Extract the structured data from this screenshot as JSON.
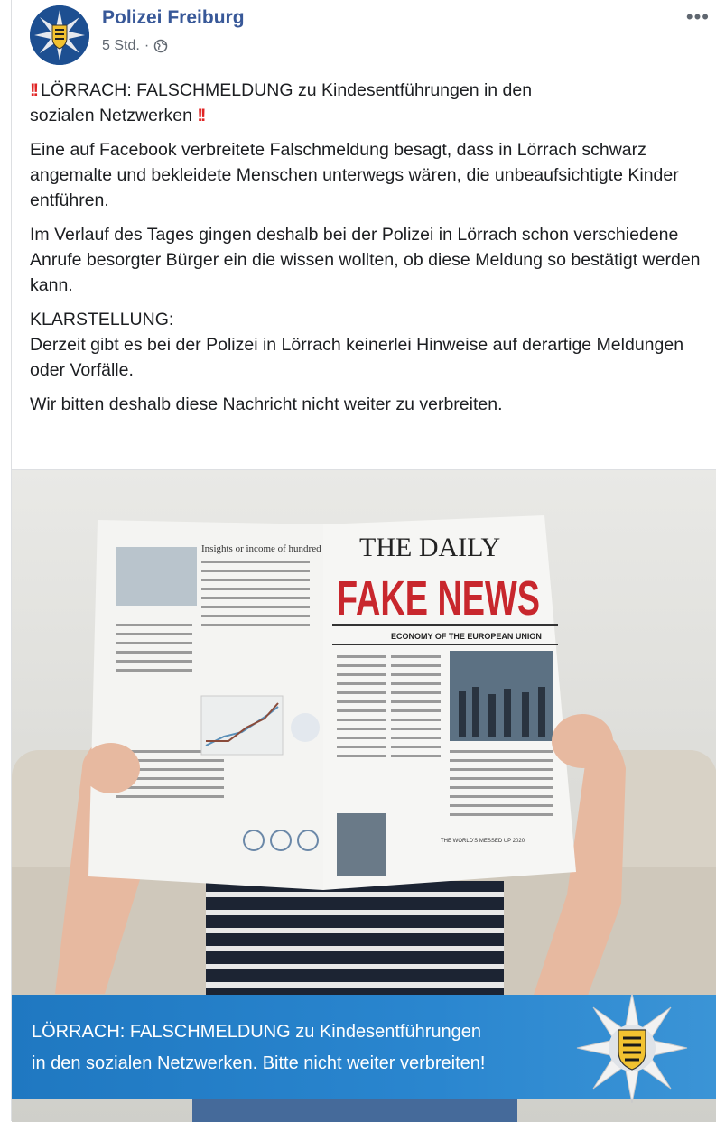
{
  "post": {
    "page_name": "Polizei Freiburg",
    "timestamp": "5 Std.",
    "separator": "·",
    "more_label": "•••",
    "headline_line1": "LÖRRACH: FALSCHMELDUNG zu Kindesentführungen in den",
    "headline_line2": "sozialen Netzwerken",
    "paragraph1": "Eine auf Facebook verbreitete Falschmeldung besagt, dass in Lörrach schwarz angemalte und bekleidete Menschen unterwegs wären, die unbeaufsichtigte Kinder entführen.",
    "paragraph2": "Im Verlauf des Tages gingen deshalb bei der Polizei in Lörrach schon verschiedene Anrufe besorgter Bürger ein die wissen wollten, ob diese Meldung so bestätigt werden kann.",
    "clarification_label": "KLARSTELLUNG:",
    "clarification_text": "Derzeit gibt es bei der Polizei in Lörrach keinerlei Hinweise auf derartige Meldungen oder Vorfälle.",
    "closing": "Wir bitten deshalb diese Nachricht nicht weiter zu verbreiten."
  },
  "image": {
    "newspaper_title1": "THE DAILY",
    "newspaper_title2": "FAKE NEWS",
    "newspaper_sub": "ECONOMY OF THE EUROPEAN UNION",
    "newspaper_left_heading": "Insights or income of hundred million dollars",
    "newspaper_footer": "THE WORLD'S MESSED UP 2020",
    "banner_line1": "LÖRRACH: FALSCHMELDUNG zu Kindesentführungen",
    "banner_line2": "in den sozialen Netzwerken. Bitte nicht weiter verbreiten!"
  },
  "colors": {
    "link": "#385898",
    "secondary": "#606770",
    "alert": "#e02424",
    "banner": "#2a86cf",
    "headline_red": "#c8272d"
  },
  "icons": [
    "police-star-avatar",
    "globe-icon",
    "more-options-icon",
    "double-exclamation-icon",
    "police-star-logo"
  ]
}
